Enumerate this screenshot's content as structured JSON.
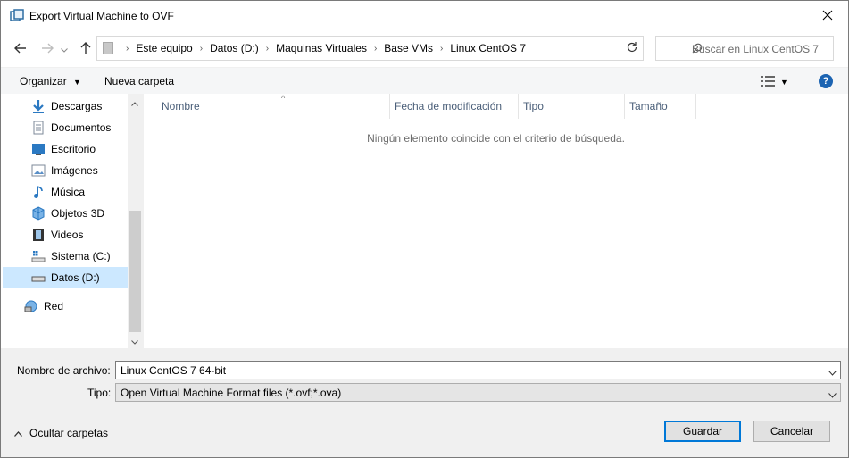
{
  "window": {
    "title": "Export Virtual Machine to OVF"
  },
  "address": {
    "crumbs": [
      "Este equipo",
      "Datos (D:)",
      "Maquinas Virtuales",
      "Base VMs",
      "Linux CentOS 7"
    ]
  },
  "search": {
    "placeholder": "Buscar en Linux CentOS 7"
  },
  "toolbar": {
    "organize_label": "Organizar",
    "new_folder_label": "Nueva carpeta"
  },
  "nav": {
    "items": [
      {
        "label": "Descargas",
        "icon": "download-icon"
      },
      {
        "label": "Documentos",
        "icon": "documents-icon"
      },
      {
        "label": "Escritorio",
        "icon": "desktop-icon"
      },
      {
        "label": "Imágenes",
        "icon": "pictures-icon"
      },
      {
        "label": "Música",
        "icon": "music-icon"
      },
      {
        "label": "Objetos 3D",
        "icon": "3d-objects-icon"
      },
      {
        "label": "Videos",
        "icon": "videos-icon"
      },
      {
        "label": "Sistema (C:)",
        "icon": "system-drive-icon"
      },
      {
        "label": "Datos (D:)",
        "icon": "drive-icon",
        "selected": true
      }
    ],
    "network": {
      "label": "Red",
      "icon": "network-icon"
    }
  },
  "filelist": {
    "columns": [
      "Nombre",
      "Fecha de modificación",
      "Tipo",
      "Tamaño"
    ],
    "empty_message": "Ningún elemento coincide con el criterio de búsqueda."
  },
  "form": {
    "filename_label": "Nombre de archivo:",
    "filename_value": "Linux CentOS 7 64-bit",
    "type_label": "Tipo:",
    "type_value": "Open Virtual Machine Format files (*.ovf;*.ova)"
  },
  "footer": {
    "hide_folders_label": "Ocultar carpetas",
    "save_label": "Guardar",
    "cancel_label": "Cancelar"
  },
  "colors": {
    "accent": "#0078d7",
    "selection": "#cce8ff",
    "help": "#1c64b2"
  }
}
